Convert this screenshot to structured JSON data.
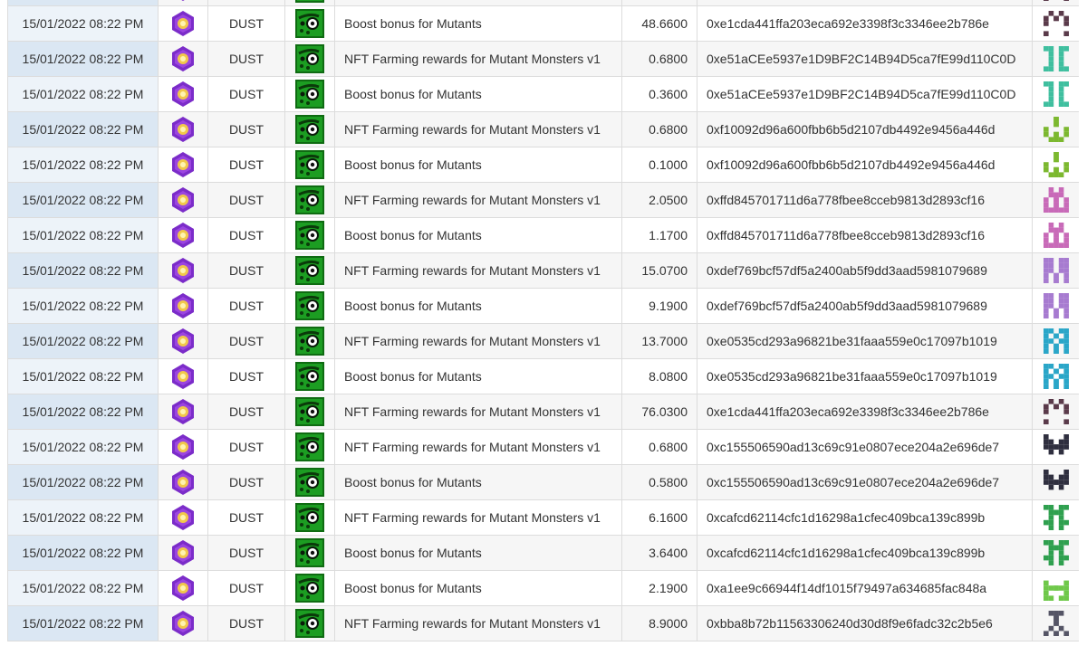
{
  "rows": [
    {
      "date": "15/01/2022 08:22 PM",
      "token_icon": "purple-hexagon-token-icon",
      "token": "DUST",
      "nft_icon": "green-mutant-monster-icon",
      "description": "Boost bonus for Mutants",
      "amount": "48.6600",
      "address": "0xe1cda441ffa203eca692e3398f3c3346ee2b786e",
      "identicon": {
        "name": "pattern-identicon",
        "color": "#5a3a4a"
      }
    },
    {
      "date": "15/01/2022 08:22 PM",
      "token_icon": "purple-hexagon-token-icon",
      "token": "DUST",
      "nft_icon": "green-mutant-monster-icon",
      "description": "NFT Farming rewards for Mutant Monsters v1",
      "amount": "0.6800",
      "address": "0xe51aCEe5937e1D9BF2C14B94D5ca7fE99d110C0D",
      "identicon": {
        "name": "pattern-identicon",
        "color": "#3fbf9f"
      }
    },
    {
      "date": "15/01/2022 08:22 PM",
      "token_icon": "purple-hexagon-token-icon",
      "token": "DUST",
      "nft_icon": "green-mutant-monster-icon",
      "description": "Boost bonus for Mutants",
      "amount": "0.3600",
      "address": "0xe51aCEe5937e1D9BF2C14B94D5ca7fE99d110C0D",
      "identicon": {
        "name": "pattern-identicon",
        "color": "#3fbf9f"
      }
    },
    {
      "date": "15/01/2022 08:22 PM",
      "token_icon": "purple-hexagon-token-icon",
      "token": "DUST",
      "nft_icon": "green-mutant-monster-icon",
      "description": "NFT Farming rewards for Mutant Monsters v1",
      "amount": "0.6800",
      "address": "0xf10092d96a600fbb6b5d2107db4492e9456a446d",
      "identicon": {
        "name": "pattern-identicon",
        "color": "#7cb82f"
      }
    },
    {
      "date": "15/01/2022 08:22 PM",
      "token_icon": "purple-hexagon-token-icon",
      "token": "DUST",
      "nft_icon": "green-mutant-monster-icon",
      "description": "Boost bonus for Mutants",
      "amount": "0.1000",
      "address": "0xf10092d96a600fbb6b5d2107db4492e9456a446d",
      "identicon": {
        "name": "pattern-identicon",
        "color": "#7cb82f"
      }
    },
    {
      "date": "15/01/2022 08:22 PM",
      "token_icon": "purple-hexagon-token-icon",
      "token": "DUST",
      "nft_icon": "green-mutant-monster-icon",
      "description": "NFT Farming rewards for Mutant Monsters v1",
      "amount": "2.0500",
      "address": "0xffd845701711d6a778fbee8cceb9813d2893cf16",
      "identicon": {
        "name": "pattern-identicon",
        "color": "#c86ab8"
      }
    },
    {
      "date": "15/01/2022 08:22 PM",
      "token_icon": "purple-hexagon-token-icon",
      "token": "DUST",
      "nft_icon": "green-mutant-monster-icon",
      "description": "Boost bonus for Mutants",
      "amount": "1.1700",
      "address": "0xffd845701711d6a778fbee8cceb9813d2893cf16",
      "identicon": {
        "name": "pattern-identicon",
        "color": "#c86ab8"
      }
    },
    {
      "date": "15/01/2022 08:22 PM",
      "token_icon": "purple-hexagon-token-icon",
      "token": "DUST",
      "nft_icon": "green-mutant-monster-icon",
      "description": "NFT Farming rewards for Mutant Monsters v1",
      "amount": "15.0700",
      "address": "0xdef769bcf57df5a2400ab5f9dd3aad5981079689",
      "identicon": {
        "name": "pattern-identicon",
        "color": "#a77bd0"
      }
    },
    {
      "date": "15/01/2022 08:22 PM",
      "token_icon": "purple-hexagon-token-icon",
      "token": "DUST",
      "nft_icon": "green-mutant-monster-icon",
      "description": "Boost bonus for Mutants",
      "amount": "9.1900",
      "address": "0xdef769bcf57df5a2400ab5f9dd3aad5981079689",
      "identicon": {
        "name": "pattern-identicon",
        "color": "#a77bd0"
      }
    },
    {
      "date": "15/01/2022 08:22 PM",
      "token_icon": "purple-hexagon-token-icon",
      "token": "DUST",
      "nft_icon": "green-mutant-monster-icon",
      "description": "NFT Farming rewards for Mutant Monsters v1",
      "amount": "13.7000",
      "address": "0xe0535cd293a96821be31faaa559e0c17097b1019",
      "identicon": {
        "name": "pattern-identicon",
        "color": "#2aa6c8"
      }
    },
    {
      "date": "15/01/2022 08:22 PM",
      "token_icon": "purple-hexagon-token-icon",
      "token": "DUST",
      "nft_icon": "green-mutant-monster-icon",
      "description": "Boost bonus for Mutants",
      "amount": "8.0800",
      "address": "0xe0535cd293a96821be31faaa559e0c17097b1019",
      "identicon": {
        "name": "pattern-identicon",
        "color": "#2aa6c8"
      }
    },
    {
      "date": "15/01/2022 08:22 PM",
      "token_icon": "purple-hexagon-token-icon",
      "token": "DUST",
      "nft_icon": "green-mutant-monster-icon",
      "description": "NFT Farming rewards for Mutant Monsters v1",
      "amount": "76.0300",
      "address": "0xe1cda441ffa203eca692e3398f3c3346ee2b786e",
      "identicon": {
        "name": "pattern-identicon",
        "color": "#5a3a4a"
      }
    },
    {
      "date": "15/01/2022 08:22 PM",
      "token_icon": "purple-hexagon-token-icon",
      "token": "DUST",
      "nft_icon": "green-mutant-monster-icon",
      "description": "NFT Farming rewards for Mutant Monsters v1",
      "amount": "0.6800",
      "address": "0xc155506590ad13c69c91e0807ece204a2e696de7",
      "identicon": {
        "name": "pattern-identicon",
        "color": "#2f2f3f"
      }
    },
    {
      "date": "15/01/2022 08:22 PM",
      "token_icon": "purple-hexagon-token-icon",
      "token": "DUST",
      "nft_icon": "green-mutant-monster-icon",
      "description": "Boost bonus for Mutants",
      "amount": "0.5800",
      "address": "0xc155506590ad13c69c91e0807ece204a2e696de7",
      "identicon": {
        "name": "pattern-identicon",
        "color": "#2f2f3f"
      }
    },
    {
      "date": "15/01/2022 08:22 PM",
      "token_icon": "purple-hexagon-token-icon",
      "token": "DUST",
      "nft_icon": "green-mutant-monster-icon",
      "description": "NFT Farming rewards for Mutant Monsters v1",
      "amount": "6.1600",
      "address": "0xcafcd62114cfc1d16298a1cfec409bca139c899b",
      "identicon": {
        "name": "pattern-identicon",
        "color": "#2fa04f"
      }
    },
    {
      "date": "15/01/2022 08:22 PM",
      "token_icon": "purple-hexagon-token-icon",
      "token": "DUST",
      "nft_icon": "green-mutant-monster-icon",
      "description": "Boost bonus for Mutants",
      "amount": "3.6400",
      "address": "0xcafcd62114cfc1d16298a1cfec409bca139c899b",
      "identicon": {
        "name": "pattern-identicon",
        "color": "#2fa04f"
      }
    },
    {
      "date": "15/01/2022 08:22 PM",
      "token_icon": "purple-hexagon-token-icon",
      "token": "DUST",
      "nft_icon": "green-mutant-monster-icon",
      "description": "Boost bonus for Mutants",
      "amount": "2.1900",
      "address": "0xa1ee9c66944f14df1015f79497a634685fac848a",
      "identicon": {
        "name": "pattern-identicon",
        "color": "#6fc84a"
      }
    },
    {
      "date": "15/01/2022 08:22 PM",
      "token_icon": "purple-hexagon-token-icon",
      "token": "DUST",
      "nft_icon": "green-mutant-monster-icon",
      "description": "NFT Farming rewards for Mutant Monsters v1",
      "amount": "8.9000",
      "address": "0xbba8b72b11563306240d30d8f9e6fadc32c2b5e6",
      "identicon": {
        "name": "pattern-identicon",
        "color": "#555566"
      }
    }
  ]
}
